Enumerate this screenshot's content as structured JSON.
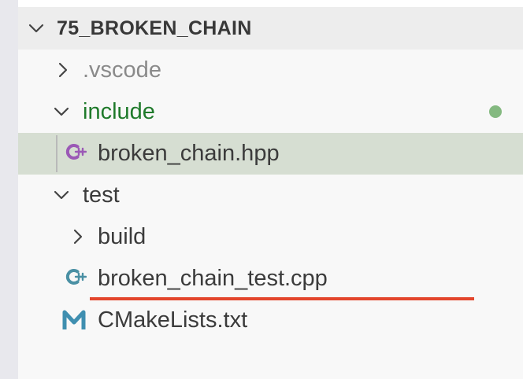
{
  "explorer": {
    "root": {
      "label": "75_BROKEN_CHAIN",
      "expanded": true
    },
    "items": [
      {
        "label": ".vscode",
        "kind": "folder",
        "expanded": false
      },
      {
        "label": "include",
        "kind": "folder",
        "expanded": true,
        "status": "modified-dot"
      },
      {
        "label": "broken_chain.hpp",
        "kind": "file",
        "icon": "cpp-header-icon",
        "selected": true
      },
      {
        "label": "test",
        "kind": "folder",
        "expanded": true
      },
      {
        "label": "build",
        "kind": "folder",
        "expanded": false
      },
      {
        "label": "broken_chain_test.cpp",
        "kind": "file",
        "icon": "cpp-file-icon",
        "annotated": true
      },
      {
        "label": "CMakeLists.txt",
        "kind": "file",
        "icon": "cmake-icon"
      }
    ]
  },
  "colors": {
    "selection": "#d6ded2",
    "git_modified_text": "#1f7a2b",
    "git_dot": "#84b980",
    "cpp_icon": "#9b59b6",
    "cpp_test_icon": "#4a90a4",
    "cmake_icon": "#3f8fb0",
    "annotation_underline": "#e3452c"
  }
}
